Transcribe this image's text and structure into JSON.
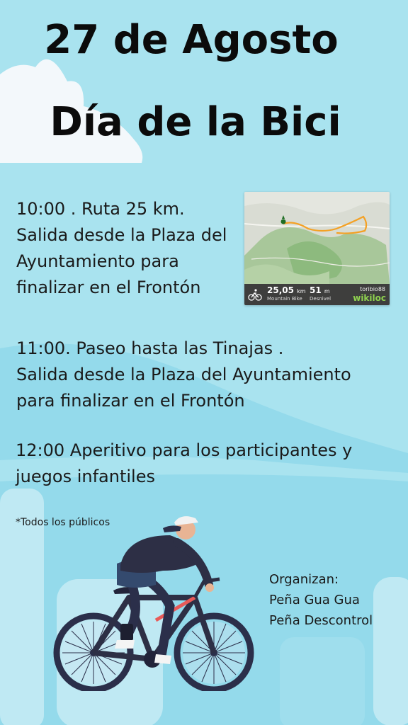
{
  "title": {
    "line1": "27 de Agosto",
    "line2": "Día de la Bici"
  },
  "events": [
    {
      "lines": [
        "10:00 . Ruta 25 km.",
        "Salida  desde la Plaza del",
        "Ayuntamiento para",
        "finalizar en el Frontón"
      ]
    },
    {
      "lines": [
        "11:00. Paseo hasta las Tinajas .",
        "Salida desde la Plaza del Ayuntamiento",
        "para finalizar en el Frontón"
      ]
    },
    {
      "lines": [
        "12:00 Aperitivo para los participantes y",
        "juegos infantiles"
      ]
    }
  ],
  "note": "*Todos los públicos",
  "organizers": {
    "heading": "Organizan:",
    "names": [
      "Peña Gua Gua",
      "Peña Descontrol"
    ]
  },
  "map_card": {
    "distance": "25,05",
    "distance_unit": "km",
    "distance_label": "Mountain Bike",
    "elevation": "51",
    "elevation_unit": "m",
    "elevation_label": "Desnivel",
    "user": "toribio88",
    "brand": "wikiloc",
    "icon": "mountain-bike-icon"
  },
  "colors": {
    "sky": "#a9e3ef",
    "wave": "#8fd8ea",
    "cloud": "#f3f8fb",
    "title": "#0b0b0b",
    "route": "#f4a124"
  }
}
